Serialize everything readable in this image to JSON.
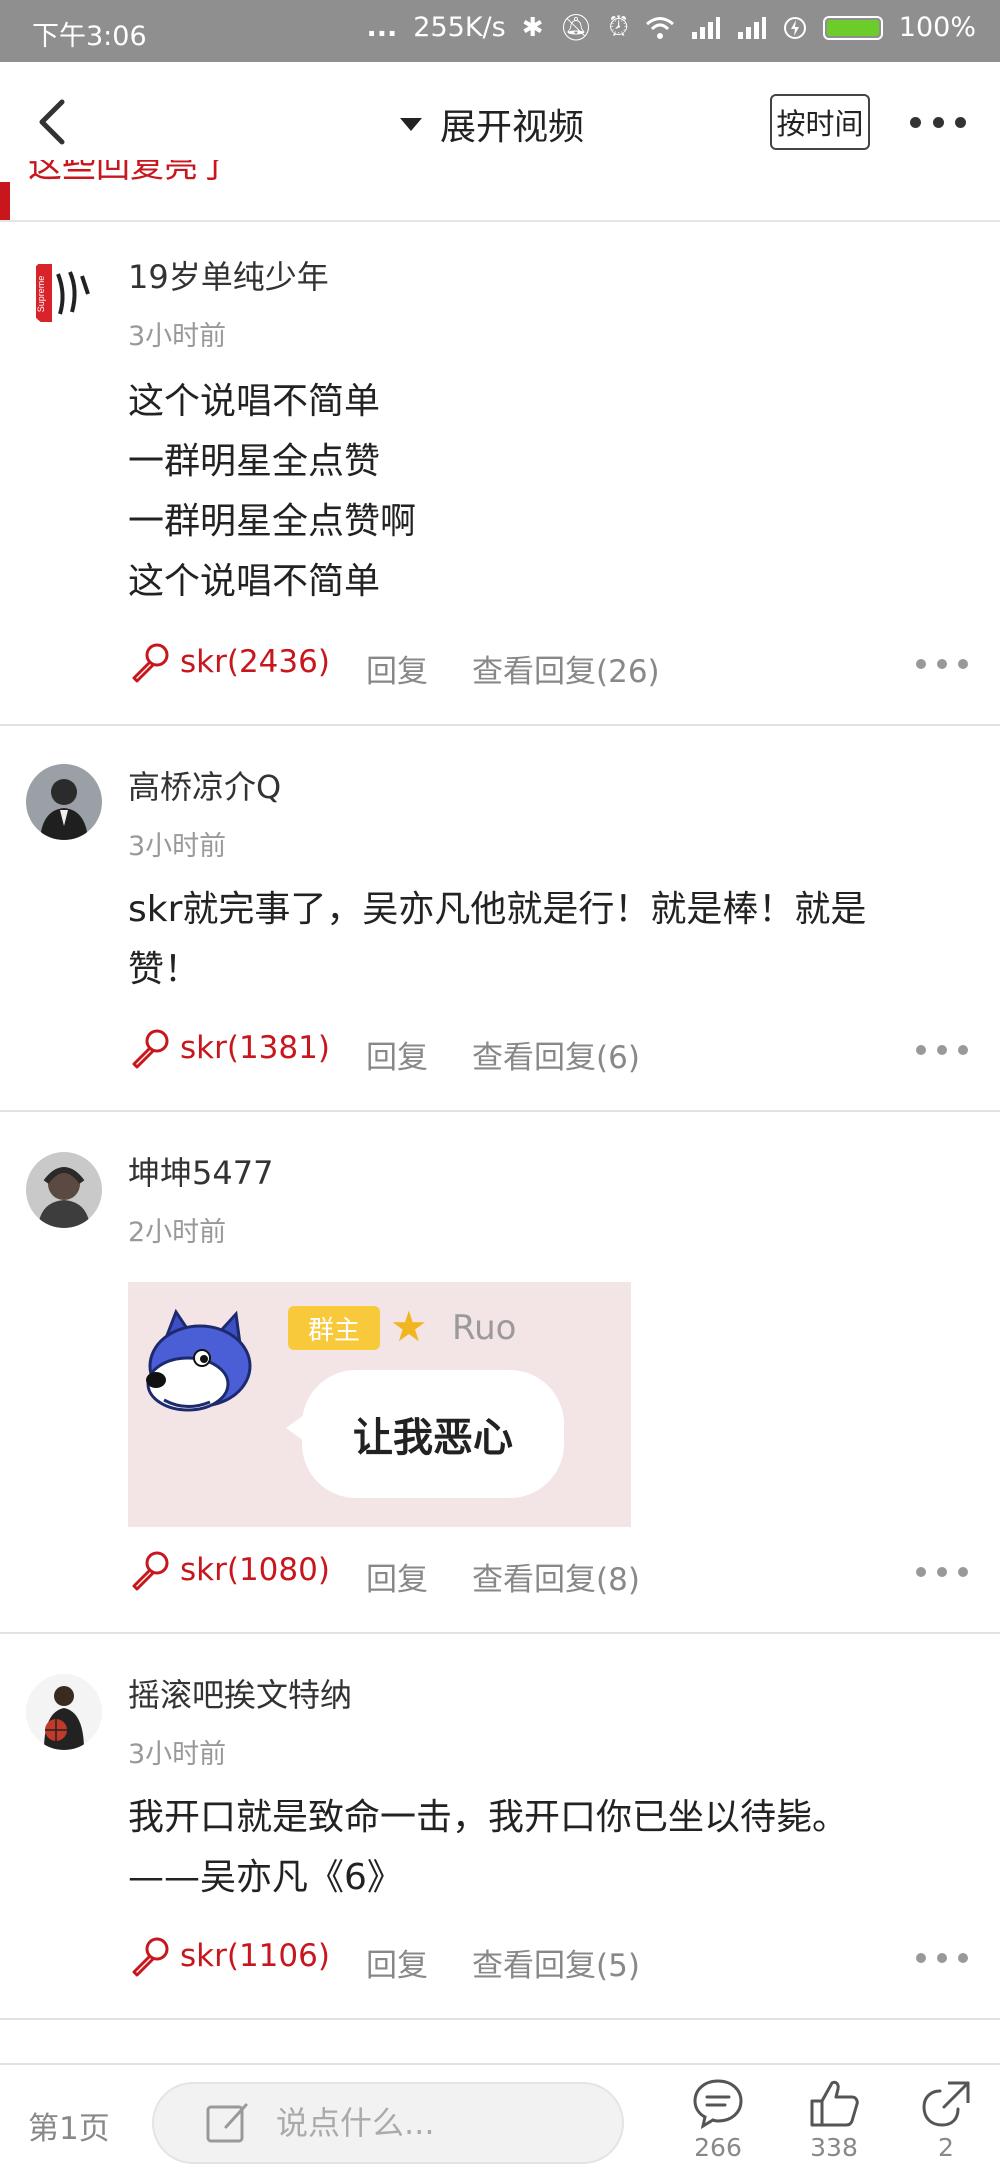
{
  "status_bar": {
    "time": "下午3:06",
    "dots": "...",
    "speed": "255K/s",
    "battery": "100%"
  },
  "nav": {
    "title": "展开视频",
    "sort_label": "按时间"
  },
  "cut_header": "这些回复亮了",
  "comments": [
    {
      "username": "19岁单纯少年",
      "time": "3小时前",
      "lines": [
        "这个说唱不简单",
        "一群明星全点赞",
        "一群明星全点赞啊",
        "这个说唱不简单"
      ],
      "likes": "skr(2436)",
      "reply": "回复",
      "view_replies": "查看回复(26)"
    },
    {
      "username": "高桥凉介Q",
      "time": "3小时前",
      "lines": [
        "skr就完事了，吴亦凡他就是行！就是棒！就是",
        "赞！"
      ],
      "likes": "skr(1381)",
      "reply": "回复",
      "view_replies": "查看回复(6)"
    },
    {
      "username": "坤坤5477",
      "time": "2小时前",
      "image": {
        "badge": "群主",
        "name": "Ruo",
        "bubble": "让我恶心"
      },
      "likes": "skr(1080)",
      "reply": "回复",
      "view_replies": "查看回复(8)"
    },
    {
      "username": "摇滚吧挨文特纳",
      "time": "3小时前",
      "lines": [
        "我开口就是致命一击，我开口你已坐以待毙。",
        "——吴亦凡《6》"
      ],
      "likes": "skr(1106)",
      "reply": "回复",
      "view_replies": "查看回复(5)"
    }
  ],
  "bottom_bar": {
    "page": "第1页",
    "input_placeholder": "说点什么...",
    "comment_count": "266",
    "like_count": "338",
    "share_count": "2"
  },
  "colors": {
    "accent": "#c8161d",
    "status_bar": "#8f8f8f",
    "battery": "#6ccc2a"
  }
}
